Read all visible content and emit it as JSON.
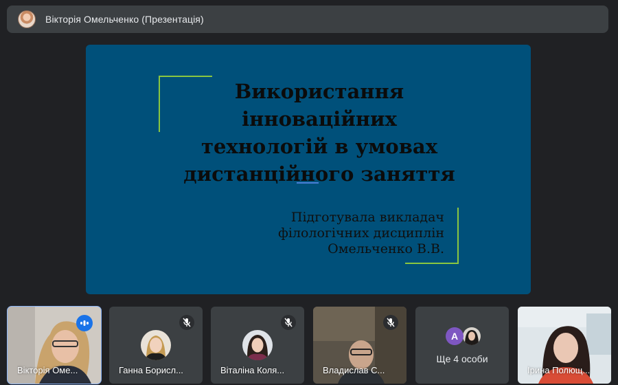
{
  "topbar": {
    "presenter_label": "Вікторія Омельченко (Презентація)"
  },
  "slide": {
    "title_lines": [
      "Використання",
      "інноваційних",
      "технологій в умовах",
      "дистанційного заняття"
    ],
    "subtitle_lines": [
      "Підготувала викладач",
      "філологічних дисциплін",
      "Омельченко В.В."
    ]
  },
  "participants": [
    {
      "name": "Вікторія Оме...",
      "state": "speaking",
      "icon": "speaking-icon"
    },
    {
      "name": "Ганна Борисл...",
      "state": "muted",
      "icon": "mic-off-icon"
    },
    {
      "name": "Віталіна Коля...",
      "state": "muted",
      "icon": "mic-off-icon"
    },
    {
      "name": "Владислав С...",
      "state": "muted",
      "icon": "mic-off-icon"
    },
    {
      "name": "Ірина Полющ...",
      "state": "video",
      "icon": ""
    }
  ],
  "more": {
    "label": "Ще 4 особи",
    "avatar_letter": "A",
    "avatar_color": "#7e57c2"
  },
  "colors": {
    "background": "#202124",
    "slide_bg": "#00507a",
    "accent_green": "#8ac640",
    "active_outline": "#8ab4f8",
    "speaking_blue": "#1a73e8"
  }
}
